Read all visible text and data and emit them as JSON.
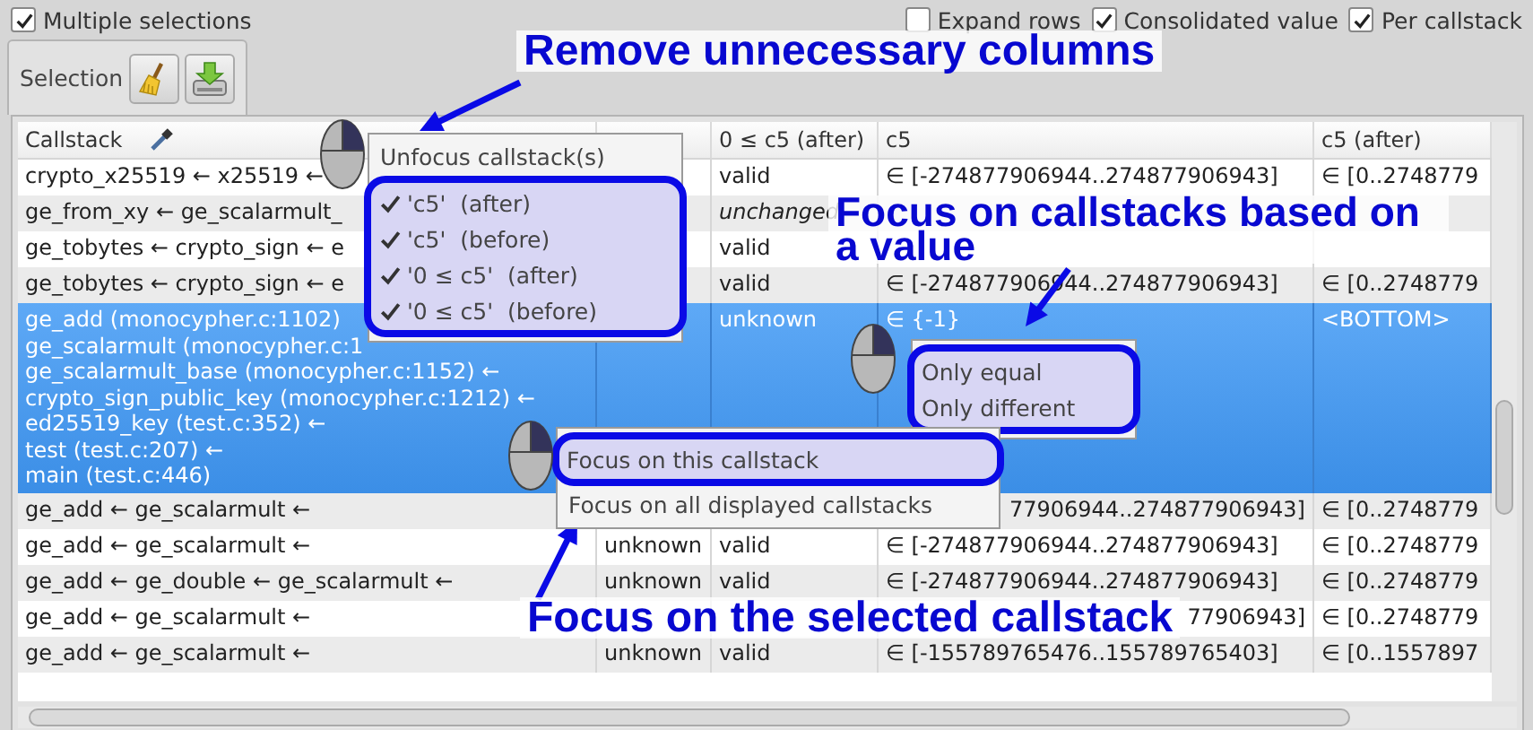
{
  "multiple_selections": {
    "label": "Multiple selections",
    "checked": true
  },
  "view_options": [
    {
      "label": "Expand rows",
      "checked": false
    },
    {
      "label": "Consolidated value",
      "checked": true
    },
    {
      "label": "Per callstack",
      "checked": true
    }
  ],
  "tabs": [
    {
      "label": "Selection",
      "selected": true
    }
  ],
  "table": {
    "columns": [
      {
        "label": "Callstack"
      },
      {},
      {
        "label": "0 ≤ c5 (after)"
      },
      {
        "label": "c5"
      },
      {
        "label": "c5 (after)"
      }
    ],
    "rows": [
      {
        "selected": false,
        "cells": [
          "crypto_x25519 ← x25519 ←",
          null,
          "valid",
          "∈ [-274877906944..274877906943]",
          "∈ [0..2748779"
        ]
      },
      {
        "selected": false,
        "cells": [
          "ge_from_xy ← ge_scalarmult_",
          null,
          {
            "text": "unchanged",
            "italic": true
          },
          null,
          null
        ]
      },
      {
        "selected": false,
        "cells": [
          "ge_tobytes ← crypto_sign ← e",
          null,
          "valid",
          null,
          null
        ]
      },
      {
        "selected": false,
        "cells": [
          "ge_tobytes ← crypto_sign ← e",
          null,
          "valid",
          "∈ [-274877906944..274877906943]",
          "∈ [0..2748779"
        ]
      },
      {
        "selected": true,
        "cells": [
          "ge_add (monocypher.c:1102)\nge_scalarmult (monocypher.c:1\nge_scalarmult_base (monocypher.c:1152) ←\ncrypto_sign_public_key (monocypher.c:1212) ←\ned25519_key (test.c:352) ←\ntest (test.c:207) ←\nmain (test.c:446)",
          null,
          "unknown",
          "∈ {-1}",
          "<BOTTOM>"
        ]
      },
      {
        "selected": false,
        "cells": [
          "ge_add ← ge_scalarmult ←",
          null,
          null,
          {
            "text": "77906944..274877906943]",
            "partial": true
          },
          "∈ [0..2748779"
        ]
      },
      {
        "selected": false,
        "cells": [
          "ge_add ← ge_scalarmult ←",
          "unknown",
          "valid",
          "∈ [-274877906944..274877906943]",
          "∈ [0..2748779"
        ]
      },
      {
        "selected": false,
        "cells": [
          "ge_add ← ge_double ← ge_scalarmult ←",
          "unknown",
          "valid",
          "∈ [-274877906944..274877906943]",
          "∈ [0..2748779"
        ]
      },
      {
        "selected": false,
        "cells": [
          "ge_add ← ge_scalarmult ←",
          null,
          null,
          {
            "text": "77906943]",
            "partial": true
          },
          "∈ [0..2748779"
        ]
      },
      {
        "selected": false,
        "cells": [
          "ge_add ← ge_scalarmult ←",
          "unknown",
          "valid",
          "∈ [-155789765476..155789765403]",
          "∈ [0..1557897"
        ]
      }
    ]
  },
  "context_menus": [
    {
      "items": [
        {
          "kind": "action",
          "label": "Unfocus callstack(s)",
          "framed": false
        },
        {
          "kind": "check",
          "label": "'c5'  (after)",
          "checked": true,
          "framed": true
        },
        {
          "kind": "check",
          "label": "'c5'  (before)",
          "checked": true,
          "framed": true
        },
        {
          "kind": "check",
          "label": "'0 ≤ c5'  (after)",
          "checked": true,
          "framed": true
        },
        {
          "kind": "check",
          "label": "'0 ≤ c5'  (before)",
          "checked": true,
          "framed": true
        }
      ]
    },
    {
      "items": [
        {
          "kind": "action",
          "label": "Only equal",
          "framed": true
        },
        {
          "kind": "action",
          "label": "Only different",
          "framed": true
        }
      ]
    },
    {
      "items": [
        {
          "kind": "action",
          "label": "Focus on this callstack",
          "framed": true
        },
        {
          "kind": "action",
          "label": "Focus on all displayed callstacks",
          "framed": false
        }
      ]
    }
  ],
  "annotations": [
    {
      "text": "Remove unnecessary columns"
    },
    {
      "text": "Focus on callstacks based on a value"
    },
    {
      "text": "Focus on the selected callstack"
    }
  ]
}
